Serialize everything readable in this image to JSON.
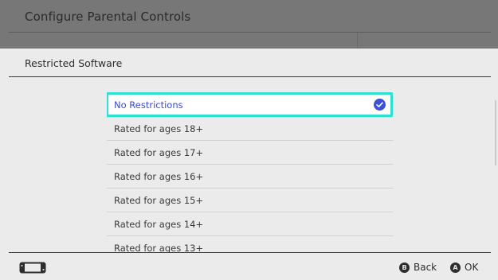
{
  "background_screen": {
    "title": "Configure Parental Controls"
  },
  "sheet": {
    "title": "Restricted Software",
    "options": [
      {
        "label": "No Restrictions",
        "selected": true
      },
      {
        "label": "Rated for ages 18+"
      },
      {
        "label": "Rated for ages 17+"
      },
      {
        "label": "Rated for ages 16+"
      },
      {
        "label": "Rated for ages 15+"
      },
      {
        "label": "Rated for ages 14+"
      },
      {
        "label": "Rated for ages 13+"
      }
    ]
  },
  "footer": {
    "back_glyph": "B",
    "back_label": "Back",
    "ok_glyph": "A",
    "ok_label": "OK",
    "console_icon": "handheld-console-icon"
  },
  "colors": {
    "selection_border": "#2ee0d0",
    "selected_text": "#3a4ad4",
    "check": "#3a52d8"
  }
}
